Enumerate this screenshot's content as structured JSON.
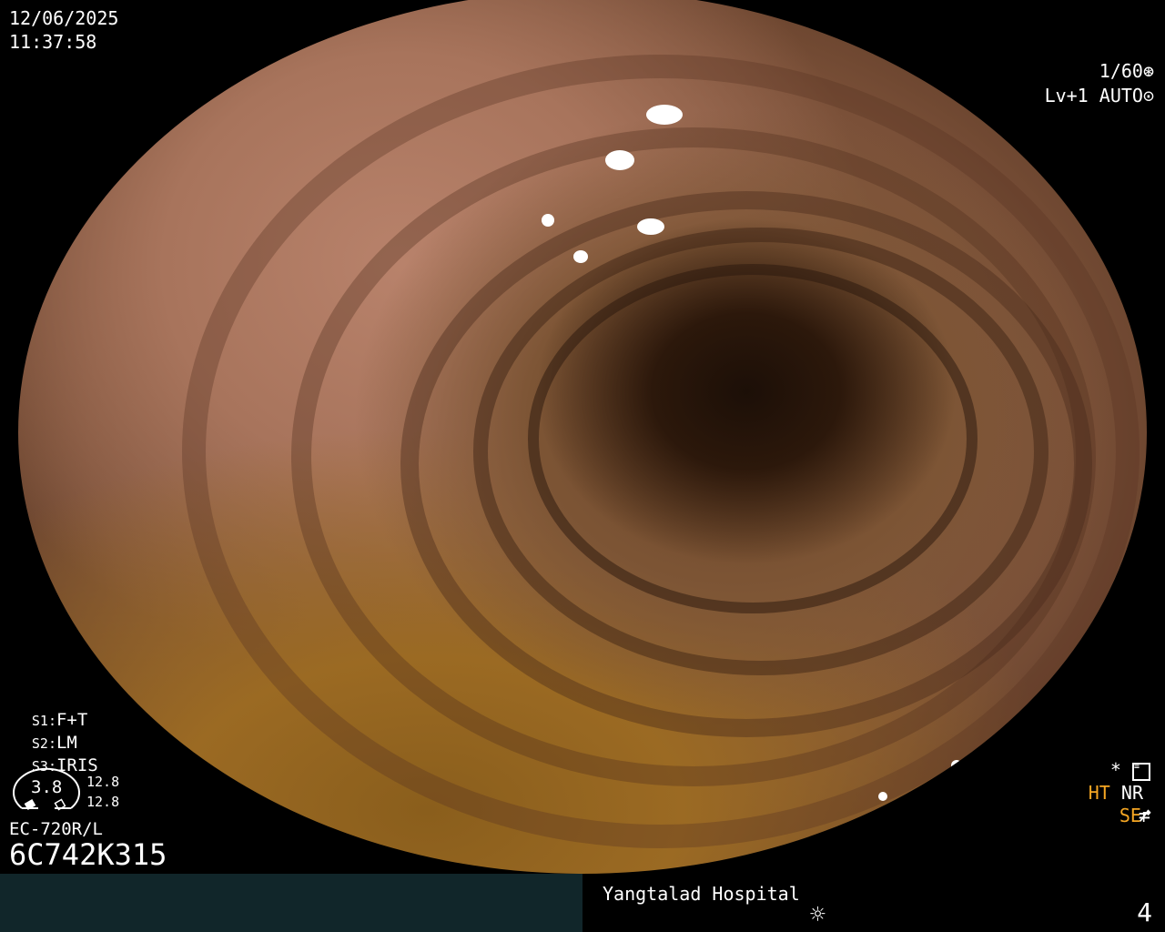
{
  "header": {
    "date": "12/06/2025",
    "time": "11:37:58"
  },
  "exposure": {
    "shutter": "1/60",
    "level": "Lv+1",
    "mode": "AUTO"
  },
  "settings": {
    "s1_label": "S1:",
    "s1_value": "F+T",
    "s2_label": "S2:",
    "s2_value": "LM",
    "s3_label": "S3:",
    "s3_value": "IRIS"
  },
  "gauge": {
    "value": "3.8",
    "top": "12.8",
    "bottom": "12.8"
  },
  "scope_model": "EC-720R/L",
  "serial": "6C742K315",
  "indicators": {
    "star": "*",
    "ht": "HT",
    "nr": "NR",
    "se": "SE"
  },
  "footer": {
    "hospital": "Yangtalad Hospital",
    "number": "4"
  },
  "icons": {
    "shutter_icon": "aperture-icon",
    "auto_icon": "auto-iris-icon",
    "menu_icon": "settings-list-icon",
    "se_icon": "structure-enhance-icon",
    "f_icon": "freeze-icon",
    "light_icon": "light-source-icon"
  },
  "colors": {
    "accent_orange": "#f5a623",
    "footer_left": "#11262a"
  }
}
